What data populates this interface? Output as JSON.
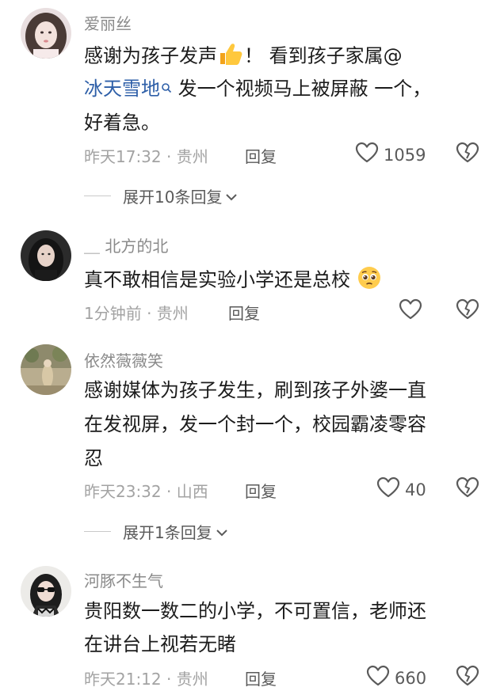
{
  "comments": [
    {
      "username": "爱丽丝",
      "line1_text": "感谢为孩子发声",
      "line1_after": "！ 看到孩子家属@",
      "mention": "冰天雪地",
      "line2_after": " 发一个视频马上被屏蔽 一个，",
      "line3": "好着急。",
      "meta": "昨天17:32 · 贵州",
      "reply_label": "回复",
      "like_count": "1059",
      "expand_label": "展开10条回复"
    },
    {
      "username": "＿ 北方的北",
      "line1_text": "真不敢相信是实验小学还是总校",
      "meta": "1分钟前 · 贵州",
      "reply_label": "回复"
    },
    {
      "username": "依然薇薇笑",
      "line1": "感谢媒体为孩子发生，刷到孩子外婆一直",
      "line2": "在发视屏，发一个封一个，校园霸凌零容",
      "line3": "忍",
      "meta": "昨天23:32 · 山西",
      "reply_label": "回复",
      "like_count": "40",
      "expand_label": "展开1条回复"
    },
    {
      "username": "河豚不生气",
      "line1": "贵阳数一数二的小学，不可置信，老师还",
      "line2": "在讲台上视若无睹",
      "meta": "昨天21:12 · 贵州",
      "reply_label": "回复",
      "like_count": "660"
    }
  ],
  "icons": {
    "like": "heart-outline-icon",
    "dislike": "broken-heart-icon",
    "expand_chevron": "chevron-down-icon",
    "thumbs_up_emoji": "thumbs-up-emoji",
    "pleading_emoji": "pleading-face-emoji",
    "search_mention": "search-icon"
  },
  "colors": {
    "mention": "#2e5fa8",
    "meta": "#a3a3a3",
    "username": "#8a8a8a"
  }
}
